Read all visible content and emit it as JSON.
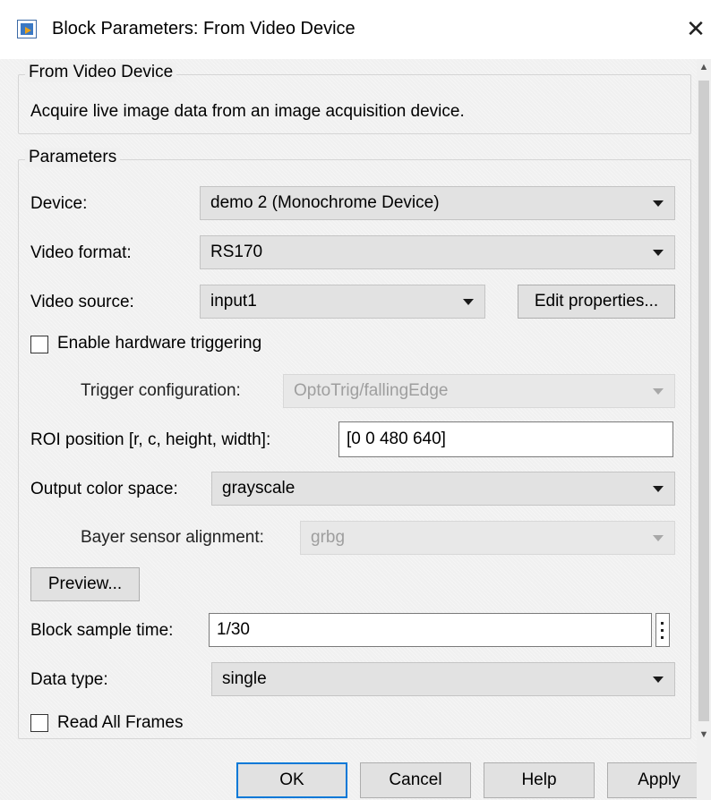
{
  "window": {
    "title": "Block Parameters: From Video Device",
    "close_glyph": "✕",
    "icon": "simulink-block-icon"
  },
  "description": {
    "legend": "From Video Device",
    "text": "Acquire live image data from an image acquisition device."
  },
  "parameters": {
    "legend": "Parameters",
    "device": {
      "label": "Device:",
      "value": "demo 2 (Monochrome Device)"
    },
    "video_format": {
      "label": "Video format:",
      "value": "RS170"
    },
    "video_source": {
      "label": "Video source:",
      "value": "input1"
    },
    "edit_properties_label": "Edit properties...",
    "hardware_triggering": {
      "label": "Enable hardware triggering",
      "checked": false
    },
    "trigger_configuration": {
      "label": "Trigger configuration:",
      "value": "OptoTrig/fallingEdge",
      "enabled": false
    },
    "roi_position": {
      "label": "ROI position [r, c, height, width]:",
      "value": "[0 0 480 640]"
    },
    "output_color_space": {
      "label": "Output color space:",
      "value": "grayscale"
    },
    "bayer_alignment": {
      "label": "Bayer sensor alignment:",
      "value": "grbg",
      "enabled": false
    },
    "preview_label": "Preview...",
    "block_sample_time": {
      "label": "Block sample time:",
      "value": "1/30"
    },
    "data_type": {
      "label": "Data type:",
      "value": "single"
    },
    "read_all_frames": {
      "label": "Read All Frames",
      "checked": false
    }
  },
  "footer": {
    "ok_label": "OK",
    "cancel_label": "Cancel",
    "help_label": "Help",
    "apply_label": "Apply"
  },
  "colors": {
    "default_button_border": "#0078d7",
    "disabled_text": "#9e9e9e"
  }
}
